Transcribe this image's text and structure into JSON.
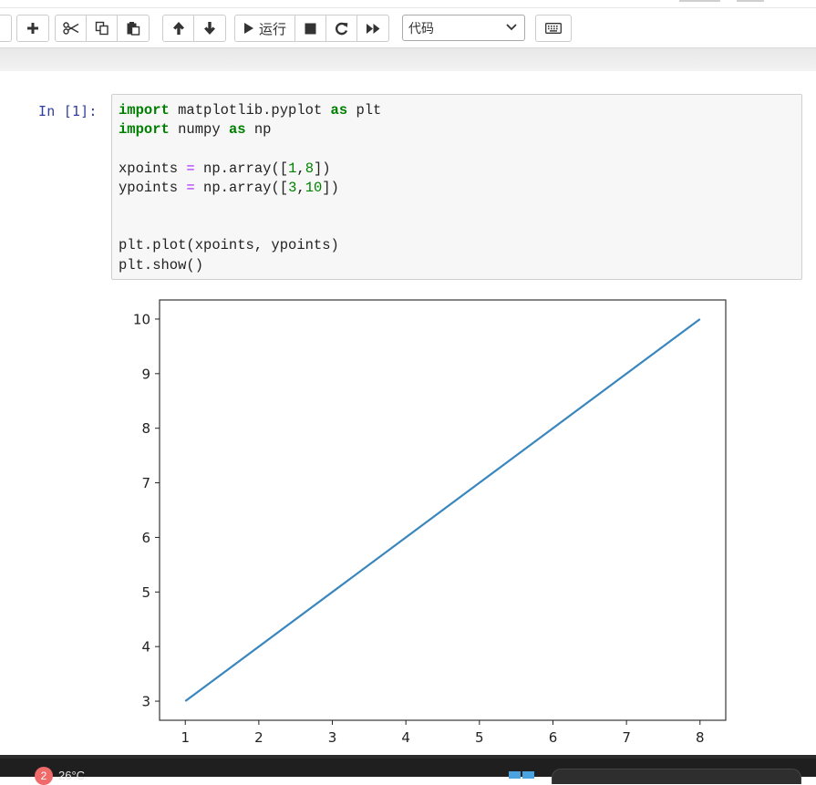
{
  "toolbar": {
    "run_label": "运行",
    "cell_type_selected": "代码"
  },
  "cell": {
    "prompt": "In  [1]:",
    "lines": [
      [
        {
          "t": "import",
          "c": "kw"
        },
        {
          "t": " matplotlib.pyplot ",
          "c": ""
        },
        {
          "t": "as",
          "c": "kw"
        },
        {
          "t": " plt",
          "c": ""
        }
      ],
      [
        {
          "t": "import",
          "c": "kw"
        },
        {
          "t": " numpy ",
          "c": ""
        },
        {
          "t": "as",
          "c": "kw"
        },
        {
          "t": " np",
          "c": ""
        }
      ],
      [],
      [
        {
          "t": "xpoints ",
          "c": ""
        },
        {
          "t": "=",
          "c": "op"
        },
        {
          "t": " np.array([",
          "c": ""
        },
        {
          "t": "1",
          "c": "num"
        },
        {
          "t": ",",
          "c": ""
        },
        {
          "t": "8",
          "c": "num"
        },
        {
          "t": "])",
          "c": ""
        }
      ],
      [
        {
          "t": "ypoints ",
          "c": ""
        },
        {
          "t": "=",
          "c": "op"
        },
        {
          "t": " np.array([",
          "c": ""
        },
        {
          "t": "3",
          "c": "num"
        },
        {
          "t": ",",
          "c": ""
        },
        {
          "t": "10",
          "c": "num"
        },
        {
          "t": "])",
          "c": ""
        }
      ],
      [],
      [],
      [
        {
          "t": "plt.plot(xpoints, ypoints)",
          "c": ""
        }
      ],
      [
        {
          "t": "plt.show()",
          "c": ""
        }
      ]
    ]
  },
  "chart_data": {
    "type": "line",
    "series": [
      {
        "x": [
          1,
          8
        ],
        "y": [
          3,
          10
        ],
        "color": "#3a86be"
      }
    ],
    "xlim": [
      0.65,
      8.35
    ],
    "ylim": [
      2.65,
      10.35
    ],
    "xticks": [
      1,
      2,
      3,
      4,
      5,
      6,
      7,
      8
    ],
    "yticks": [
      3,
      4,
      5,
      6,
      7,
      8,
      9,
      10
    ],
    "grid": false
  },
  "taskbar": {
    "badge": "2",
    "temperature": "26°C"
  }
}
